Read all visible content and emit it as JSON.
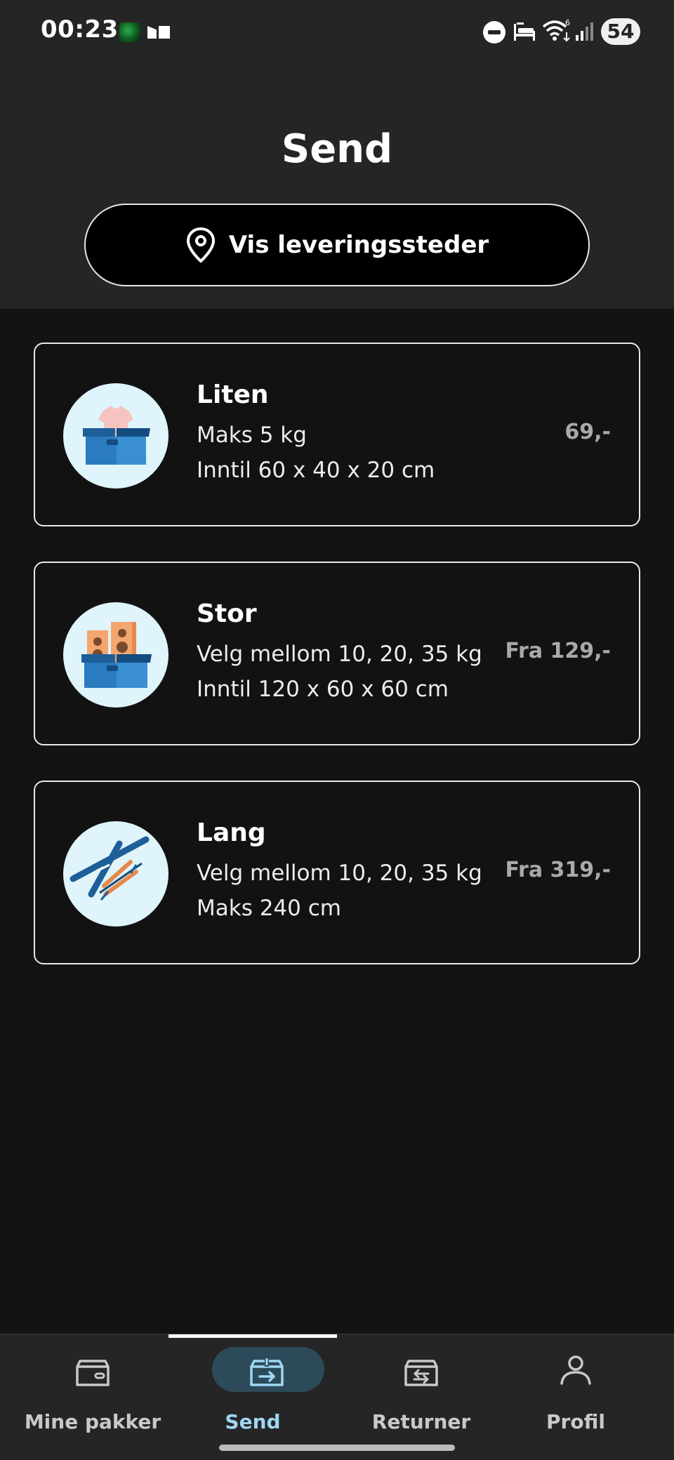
{
  "status_bar": {
    "time": "00:23",
    "battery": "54"
  },
  "header": {
    "title": "Send",
    "locations_button": "Vis leveringssteder"
  },
  "cards": [
    {
      "name": "Liten",
      "line1": "Maks 5 kg",
      "line2": "Inntil 60 x 40 x 20 cm",
      "price": "69,-",
      "icon": "tshirt-box-icon"
    },
    {
      "name": "Stor",
      "line1": "Velg mellom 10, 20, 35 kg",
      "line2": "Inntil 120 x 60 x 60 cm",
      "price": "Fra 129,-",
      "icon": "speakers-box-icon"
    },
    {
      "name": "Lang",
      "line1": "Velg mellom 10, 20, 35 kg",
      "line2": "Maks 240 cm",
      "price": "Fra 319,-",
      "icon": "skis-icon"
    }
  ],
  "nav": [
    {
      "label": "Mine pakker",
      "icon": "package-icon",
      "active": false
    },
    {
      "label": "Send",
      "icon": "send-package-icon",
      "active": true
    },
    {
      "label": "Returner",
      "icon": "return-package-icon",
      "active": false
    },
    {
      "label": "Profil",
      "icon": "profile-icon",
      "active": false
    }
  ],
  "colors": {
    "background": "#131313",
    "header": "#252525",
    "accent": "#9fd6f2",
    "active_pill": "#2c4a5a",
    "price": "#a9a9a9"
  }
}
